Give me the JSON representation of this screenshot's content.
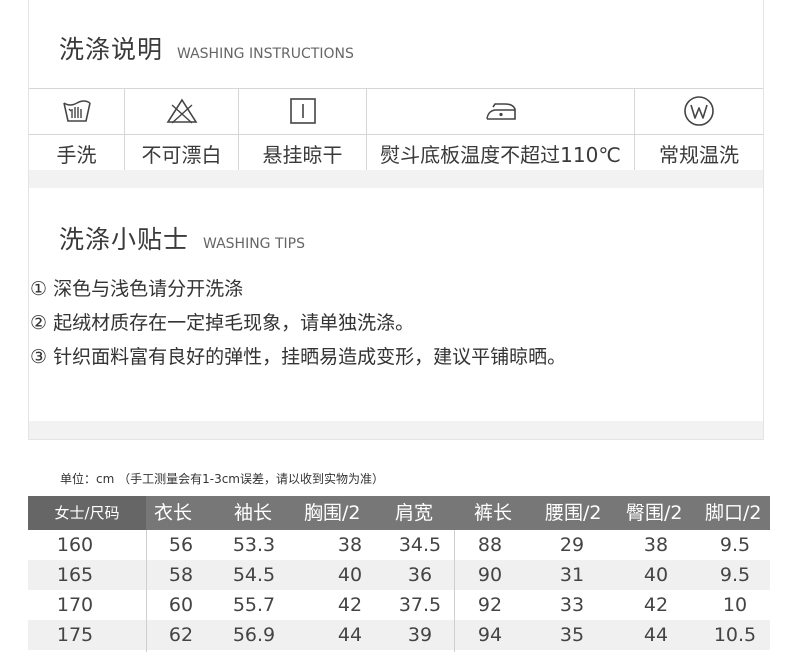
{
  "washing": {
    "title_cn": "洗涤说明",
    "title_en": "WASHING INSTRUCTIONS",
    "items": [
      {
        "label": "手洗",
        "icon": "hand-wash-icon"
      },
      {
        "label": "不可漂白",
        "icon": "no-bleach-icon"
      },
      {
        "label": "悬挂晾干",
        "icon": "line-dry-icon"
      },
      {
        "label": "熨斗底板温度不超过110℃",
        "icon": "iron-icon"
      },
      {
        "label": "常规温洗",
        "icon": "wet-clean-icon"
      }
    ]
  },
  "tips": {
    "title_cn": "洗涤小贴士",
    "title_en": "WASHING TIPS",
    "items": [
      "① 深色与浅色请分开洗涤",
      "② 起绒材质存在一定掉毛现象，请单独洗涤。",
      "③ 针织面料富有良好的弹性，挂晒易造成变形，建议平铺晾晒。"
    ]
  },
  "size_table": {
    "note": "单位：cm （手工测量会有1-3cm误差，请以收到实物为准）",
    "headers": [
      "女士/尺码",
      "衣长",
      "袖长",
      "胸围/2",
      "肩宽",
      "裤长",
      "腰围/2",
      "臀围/2",
      "脚口/2"
    ],
    "rows": [
      [
        "160",
        "56",
        "53.3",
        "38",
        "34.5",
        "88",
        "29",
        "38",
        "9.5"
      ],
      [
        "165",
        "58",
        "54.5",
        "40",
        "36",
        "90",
        "31",
        "40",
        "9.5"
      ],
      [
        "170",
        "60",
        "55.7",
        "42",
        "37.5",
        "92",
        "33",
        "42",
        "10"
      ],
      [
        "175",
        "62",
        "56.9",
        "44",
        "39",
        "94",
        "35",
        "44",
        "10.5"
      ]
    ]
  }
}
